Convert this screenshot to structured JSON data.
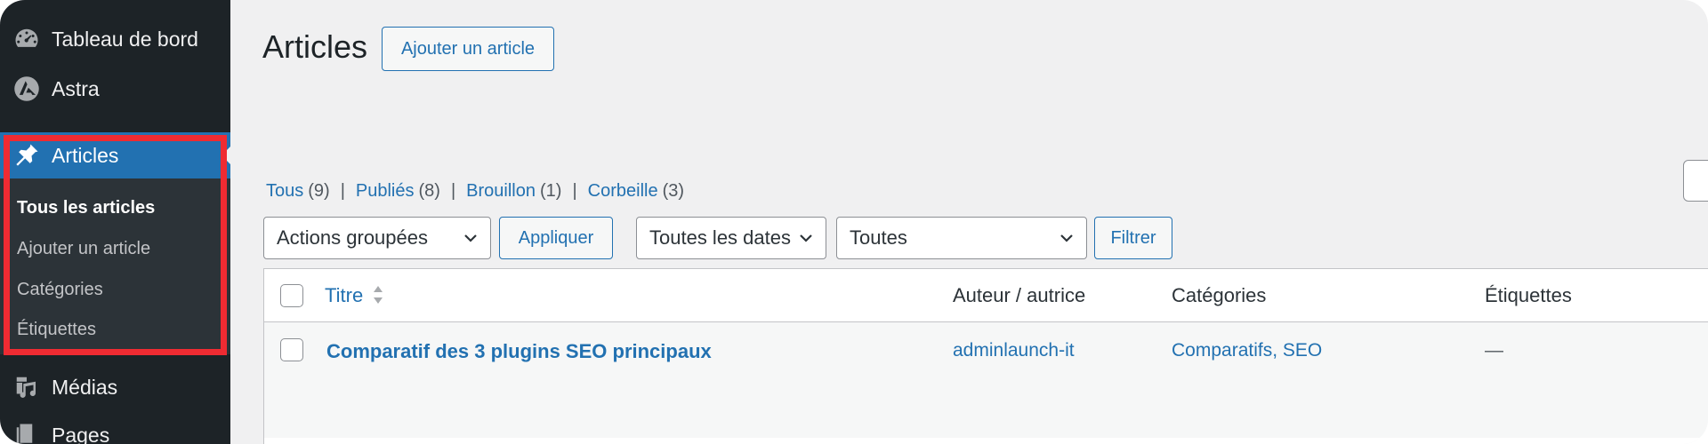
{
  "sidebar": {
    "dashboard": {
      "label": "Tableau de bord",
      "icon": "dashboard-icon"
    },
    "astra": {
      "label": "Astra",
      "icon": "astra-logo-icon"
    },
    "articles": {
      "label": "Articles",
      "icon": "pin-icon"
    },
    "submenu": [
      {
        "label": "Tous les articles",
        "current": true
      },
      {
        "label": "Ajouter un article",
        "current": false
      },
      {
        "label": "Catégories",
        "current": false
      },
      {
        "label": "Étiquettes",
        "current": false
      }
    ],
    "media": {
      "label": "Médias",
      "icon": "media-icon"
    },
    "pages": {
      "label": "Pages",
      "icon": "pages-icon"
    }
  },
  "header": {
    "title": "Articles",
    "add_button": "Ajouter un article"
  },
  "filters": {
    "views": [
      {
        "label": "Tous",
        "count": "(9)"
      },
      {
        "label": "Publiés",
        "count": "(8)"
      },
      {
        "label": "Brouillon",
        "count": "(1)"
      },
      {
        "label": "Corbeille",
        "count": "(3)"
      }
    ],
    "separator": "|",
    "bulk_actions": "Actions groupées",
    "apply_button": "Appliquer",
    "dates": "Toutes les dates",
    "categories": "Toutes",
    "filter_button": "Filtrer"
  },
  "table": {
    "columns": {
      "title": "Titre",
      "author": "Auteur / autrice",
      "categories": "Catégories",
      "tags": "Étiquettes"
    },
    "rows": [
      {
        "title": "Comparatif des 3 plugins SEO principaux",
        "author": "adminlaunch-it",
        "categories": "Comparatifs, SEO",
        "tags": "—"
      }
    ]
  },
  "colors": {
    "sidebar_bg": "#1d2327",
    "submenu_bg": "#2c3338",
    "accent": "#2271b1",
    "highlight": "#ef2b32",
    "content_bg": "#f0f0f1"
  }
}
